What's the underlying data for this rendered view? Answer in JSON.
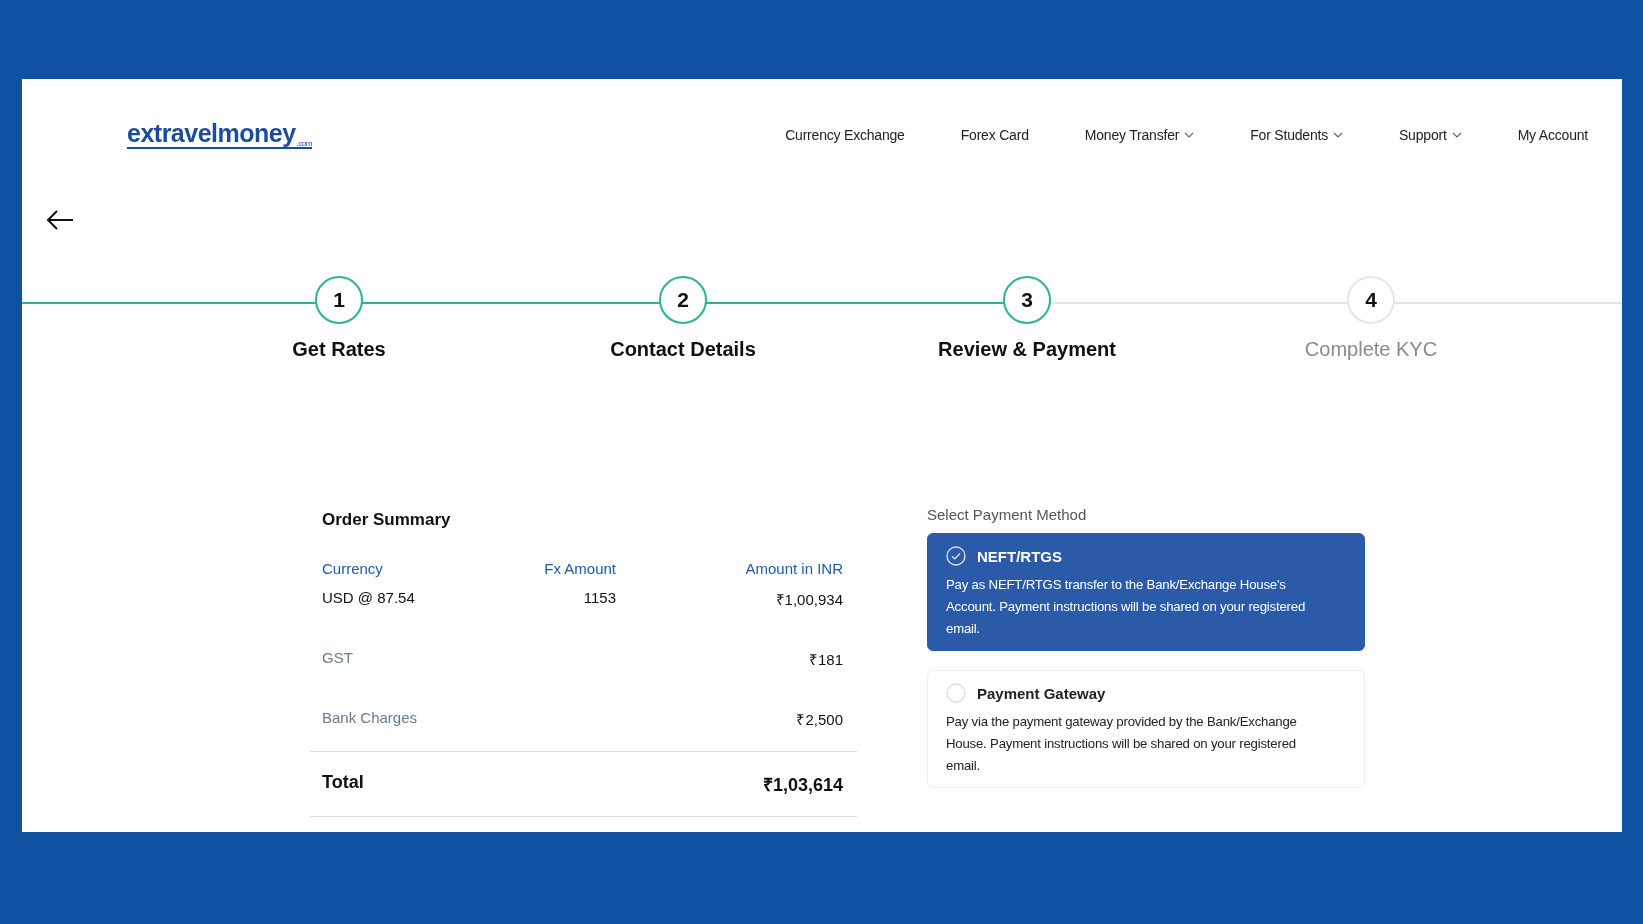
{
  "header": {
    "logo": {
      "text": "extravelmoney",
      "suffix": ".com"
    },
    "nav": [
      {
        "label": "Currency Exchange",
        "dropdown": false
      },
      {
        "label": "Forex Card",
        "dropdown": false
      },
      {
        "label": "Money Transfer",
        "dropdown": true
      },
      {
        "label": "For Students",
        "dropdown": true
      },
      {
        "label": "Support",
        "dropdown": true
      },
      {
        "label": "My Account",
        "dropdown": false
      }
    ]
  },
  "steps": [
    {
      "number": "1",
      "label": "Get Rates",
      "completed": true
    },
    {
      "number": "2",
      "label": "Contact Details",
      "completed": true
    },
    {
      "number": "3",
      "label": "Review & Payment",
      "completed": true
    },
    {
      "number": "4",
      "label": "Complete KYC",
      "completed": false
    }
  ],
  "order_summary": {
    "title": "Order Summary",
    "columns": [
      "Currency",
      "Fx Amount",
      "Amount in INR"
    ],
    "rows": [
      [
        "USD @ 87.54",
        "1153",
        "₹1,00,934"
      ]
    ],
    "charges": [
      {
        "label": "GST",
        "amount": "₹181"
      },
      {
        "label": "Bank Charges",
        "amount": "₹2,500"
      }
    ],
    "total": {
      "label": "Total",
      "amount": "₹1,03,614"
    }
  },
  "payment": {
    "title": "Select Payment Method",
    "options": [
      {
        "name": "NEFT/RTGS",
        "description": "Pay as NEFT/RTGS transfer to the Bank/Exchange House's Account. Payment instructions will be shared on your registered email.",
        "selected": true
      },
      {
        "name": "Payment Gateway",
        "description": "Pay via the payment gateway provided by the Bank/Exchange House. Payment instructions will be shared on your registered email.",
        "selected": false
      }
    ]
  }
}
